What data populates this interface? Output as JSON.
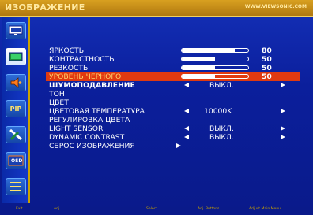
{
  "header": {
    "title": "ИЗОБРАЖЕНИЕ",
    "site": "WWW.VIEWSONIC.COM"
  },
  "sidebar": {
    "items": [
      {
        "icon": "tv-screen-icon"
      },
      {
        "icon": "picture-icon",
        "selected": true
      },
      {
        "icon": "sound-icon"
      },
      {
        "label": "PIP",
        "icon": "pip-icon"
      },
      {
        "icon": "tools-icon"
      },
      {
        "label": "OSD",
        "icon": "osd-icon"
      },
      {
        "icon": "list-icon"
      }
    ]
  },
  "menu": {
    "brightness": {
      "label": "ЯРКОСТЬ",
      "value": "80",
      "level": 0.8
    },
    "contrast": {
      "label": "КОНТРАСТНОСТЬ",
      "value": "50",
      "level": 0.5
    },
    "sharpness": {
      "label": "РЕЗКОСТЬ",
      "value": "50",
      "level": 0.5
    },
    "black_level": {
      "label": "УРОВЕНЬ ЧЕРНОГО",
      "value": "50",
      "level": 0.5
    },
    "noise_reduction": {
      "label": "ШУМОПОДАВЛЕНИЕ",
      "option": "ВЫКЛ."
    },
    "tint": {
      "label": "ТОН"
    },
    "color": {
      "label": "ЦВЕТ"
    },
    "color_temp": {
      "label": "ЦВЕТОВАЯ ТЕМПЕРАТУРА",
      "option": "10000K"
    },
    "color_adjust": {
      "label": "РЕГУЛИРОВКА ЦВЕТА"
    },
    "light_sensor": {
      "label": "LIGHT SENSOR",
      "option": "ВЫКЛ."
    },
    "dynamic_contrast": {
      "label": "DYNAMIC CONTRAST",
      "option": "ВЫКЛ."
    },
    "reset": {
      "label": "СБРОС ИЗОБРАЖЕНИЯ"
    }
  },
  "footer": {
    "items": [
      "Exit",
      "Adj",
      "Select",
      "Adj. Buttons",
      "Adjust Main Menu"
    ]
  },
  "colors": {
    "selected_row": "#e03a10",
    "accent": "#c9a200",
    "background": "#0a1a8a"
  }
}
